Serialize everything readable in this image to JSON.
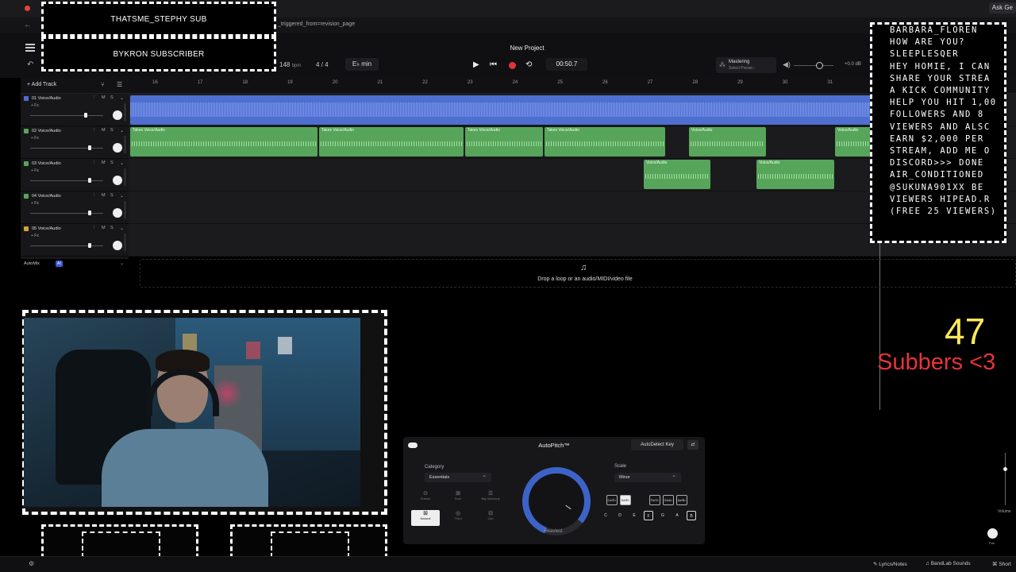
{
  "browser": {
    "url_fragment": "_triggered_from=revision_page",
    "ask_button": "Ask Ge"
  },
  "overlay": {
    "top_banner_1": "THATSME_STEPHY SUB",
    "top_banner_2": "BYKRON SUBSCRIBER",
    "sub_count": "47",
    "sub_label": "Subbers <3",
    "chat": [
      "BARBARA_FLOREN",
      "HOW ARE YOU?",
      "SLEEPLESQER",
      "HEY HOMIE, I CAN",
      "SHARE YOUR STREA",
      "A KICK COMMUNITY",
      "HELP YOU HIT 1,00",
      "FOLLOWERS AND 8",
      "VIEWERS AND ALSC",
      "EARN $2,000 PER",
      "STREAM, ADD ME O",
      "DISCORD>>> DONE",
      "AIR_CONDITIONED",
      "@SUKUNA901XX BE",
      "VIEWERS HIPEAD.R",
      "(FREE 25 VIEWERS)"
    ]
  },
  "header": {
    "project_title": "New Project",
    "tempo": "148",
    "tempo_unit": "bpm",
    "time_signature": "4 / 4",
    "key": "E♭ min",
    "timecode": "00:50.7",
    "mastering_title": "Mastering",
    "mastering_sub": "Select Preset ›",
    "db_readout": "+0.0 dB"
  },
  "tracks_header": {
    "add_track": "Add Track"
  },
  "ruler": [
    "16",
    "17",
    "18",
    "19",
    "20",
    "21",
    "22",
    "23",
    "24",
    "25",
    "26",
    "27",
    "28",
    "29",
    "30",
    "31"
  ],
  "tracks": [
    {
      "name": "01 Voice/Audio",
      "fx": "+ Fx",
      "color": "#4e6fd0",
      "fader": 0.76
    },
    {
      "name": "02 Voice/Audio",
      "fx": "+ Fx",
      "color": "#57a55a",
      "fader": 0.82
    },
    {
      "name": "03 Voice/Audio",
      "fx": "+ Fx",
      "color": "#57a55a",
      "fader": 0.82
    },
    {
      "name": "04 Voice/Audio",
      "fx": "+ Fx",
      "color": "#57a55a",
      "fader": 0.82
    },
    {
      "name": "05 Voice/Audio",
      "fx": "+ Fx",
      "color": "#d1a23a",
      "fader": 0.82
    }
  ],
  "mute_label": "M",
  "solo_label": "S",
  "clips": {
    "take_label": "Takes",
    "voice_label": "Voice/Audio"
  },
  "automix": {
    "label": "AutoMix",
    "badge": "AI"
  },
  "dropzone": {
    "text": "Drop a loop or an audio/MIDI/video file"
  },
  "autopitch": {
    "title": "AutoPitch™",
    "autodetect": "AutoDetect Key",
    "category_label": "Category",
    "category_value": "Essentials",
    "effects": [
      {
        "name": "Classic",
        "icon": "⊙"
      },
      {
        "name": "Duet",
        "icon": "⊞"
      },
      {
        "name": "Big Harmony",
        "icon": "☰"
      },
      {
        "name": "Natural",
        "icon": "⊠"
      },
      {
        "name": "Third",
        "icon": "◎"
      },
      {
        "name": "Clip",
        "icon": "⊟"
      }
    ],
    "dial_label": "Heaviest",
    "scale_label": "Scale",
    "scale_value": "Minor",
    "black_keys": [
      "C#/D♭",
      "D#/E♭",
      "F#/G♭",
      "G#/A♭",
      "A#/B♭"
    ],
    "white_keys": [
      "C",
      "D",
      "E",
      "F",
      "G",
      "A",
      "B"
    ]
  },
  "right_panel": {
    "volume_label": "Volume",
    "pan_label": "Pan"
  },
  "bottom_bar": {
    "lyrics": "Lyrics/Notes",
    "sounds": "BandLab Sounds",
    "shortcuts": "Short"
  }
}
